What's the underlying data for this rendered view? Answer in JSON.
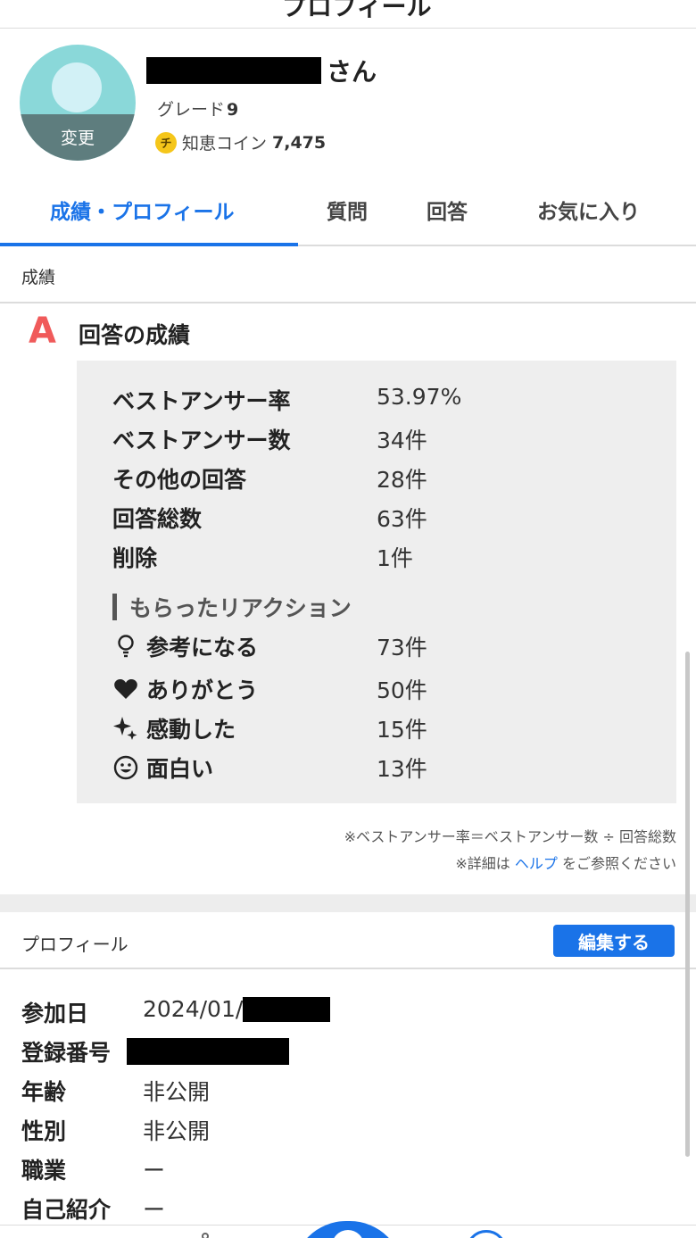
{
  "header": {
    "cut_title": "プロフィール"
  },
  "profile": {
    "avatar_change_label": "変更",
    "name_suffix": "さん",
    "grade_label": "グレード",
    "grade_value": "9",
    "coin_icon_char": "チ",
    "coin_label": "知恵コイン",
    "coin_value": "7,475"
  },
  "tabs": [
    {
      "label": "成績・プロフィール",
      "active": true
    },
    {
      "label": "質問",
      "active": false
    },
    {
      "label": "回答",
      "active": false
    },
    {
      "label": "お気に入り",
      "active": false
    }
  ],
  "sections": {
    "seiseki": "成績"
  },
  "answers": {
    "grade_letter": "A",
    "title": "回答の成績",
    "stats": [
      {
        "label": "ベストアンサー率",
        "value": "53.97%"
      },
      {
        "label": "ベストアンサー数",
        "value": "34件"
      },
      {
        "label": "その他の回答",
        "value": "28件"
      },
      {
        "label": "回答総数",
        "value": "63件"
      },
      {
        "label": "削除",
        "value": "1件"
      }
    ],
    "reactions_title": "もらったリアクション",
    "reactions": [
      {
        "icon": "lightbulb-icon",
        "label": "参考になる",
        "value": "73件"
      },
      {
        "icon": "heart-icon",
        "label": "ありがとう",
        "value": "50件"
      },
      {
        "icon": "sparkle-icon",
        "label": "感動した",
        "value": "15件"
      },
      {
        "icon": "smiley-icon",
        "label": "面白い",
        "value": "13件"
      }
    ],
    "note_formula": "※ベストアンサー率＝ベストアンサー数 ÷ 回答総数",
    "note_help_prefix": "※詳細は",
    "note_help_link": "ヘルプ",
    "note_help_suffix": "をご参照ください"
  },
  "profile_section": {
    "title": "プロフィール",
    "edit_label": "編集する",
    "rows": [
      {
        "label": "参加日",
        "value": "2024/01/"
      },
      {
        "label": "登録番号",
        "value": ""
      },
      {
        "label": "年齢",
        "value": "非公開"
      },
      {
        "label": "性別",
        "value": "非公開"
      },
      {
        "label": "職業",
        "value": "ー"
      },
      {
        "label": "自己紹介",
        "value": "ー"
      }
    ]
  },
  "colors": {
    "accent": "#1a73e8",
    "grade_letter": "#f05a5a",
    "stats_bg": "#eeeeee"
  }
}
